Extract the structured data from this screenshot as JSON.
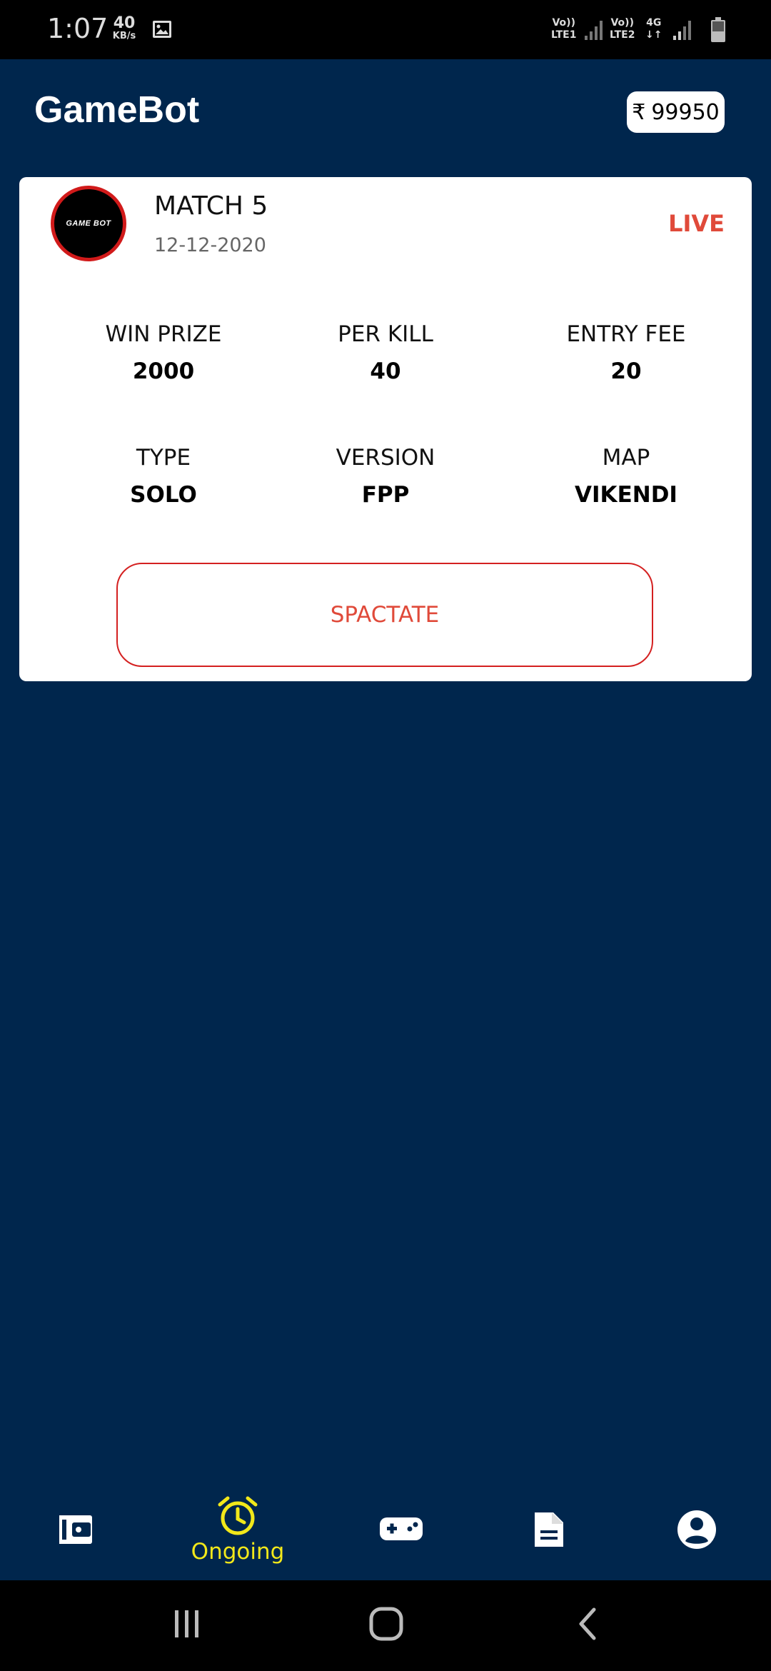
{
  "status_bar": {
    "time": "1:07",
    "net_speed": "40",
    "net_speed_unit": "KB/s",
    "sim1_label_top": "Vo))",
    "sim1_label_bottom": "LTE1",
    "sim2_label_top": "Vo))",
    "sim2_label_bottom": "LTE2",
    "data_type": "4G",
    "data_arrows": "↓↑"
  },
  "header": {
    "title": "GameBot",
    "balance_currency": "₹",
    "balance_amount": "99950"
  },
  "match": {
    "logo_text": "GAME BOT",
    "title": "MATCH 5",
    "date": "12-12-2020",
    "status": "LIVE",
    "stats": [
      {
        "label": "WIN PRIZE",
        "value": "2000"
      },
      {
        "label": "PER KILL",
        "value": "40"
      },
      {
        "label": "ENTRY FEE",
        "value": "20"
      },
      {
        "label": "TYPE",
        "value": "SOLO"
      },
      {
        "label": "VERSION",
        "value": "FPP"
      },
      {
        "label": "MAP",
        "value": "VIKENDI"
      }
    ],
    "action_label": "SPACTATE"
  },
  "bottom_nav": {
    "items": [
      {
        "icon": "wallet-icon",
        "label": ""
      },
      {
        "icon": "alarm-clock-icon",
        "label": "Ongoing"
      },
      {
        "icon": "gamepad-icon",
        "label": ""
      },
      {
        "icon": "document-icon",
        "label": ""
      },
      {
        "icon": "account-circle-icon",
        "label": ""
      }
    ],
    "active_index": 1
  },
  "colors": {
    "background": "#00264d",
    "card": "#ffffff",
    "live": "#e04a3a",
    "button_border": "#d42020",
    "active_nav": "#f2e81a"
  }
}
